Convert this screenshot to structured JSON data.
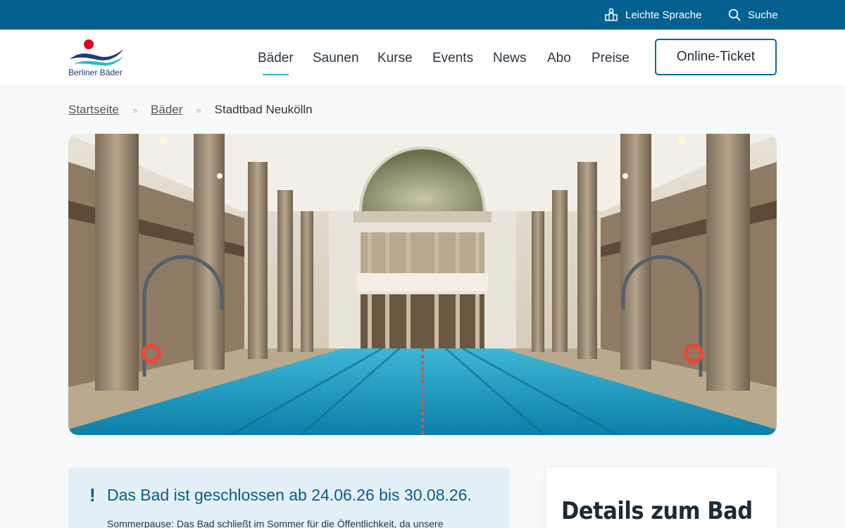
{
  "topbar": {
    "leichte_sprache": "Leichte Sprache",
    "suche": "Suche"
  },
  "header": {
    "logo_text": "Berliner Bäder",
    "nav": [
      {
        "label": "Bäder",
        "active": true
      },
      {
        "label": "Saunen"
      },
      {
        "label": "Kurse"
      },
      {
        "label": "Events"
      },
      {
        "label": "News"
      },
      {
        "label": "Abo"
      },
      {
        "label": "Preise"
      }
    ],
    "ticket_button": "Online-Ticket"
  },
  "breadcrumb": {
    "items": [
      "Startseite",
      "Bäder"
    ],
    "current": "Stadtbad Neukölln"
  },
  "notice": {
    "title": "Das Bad ist geschlossen ab 24.06.26 bis 30.08.26.",
    "text": "Sommerpause: Das Bad schließt im Sommer für die Öffentlichkeit, da unsere"
  },
  "details": {
    "title": "Details zum Bad"
  },
  "colors": {
    "topbar": "#04618f",
    "accent": "#2fb9c7",
    "notice_bg": "#e4f0f7",
    "notice_text": "#0a5c86"
  }
}
